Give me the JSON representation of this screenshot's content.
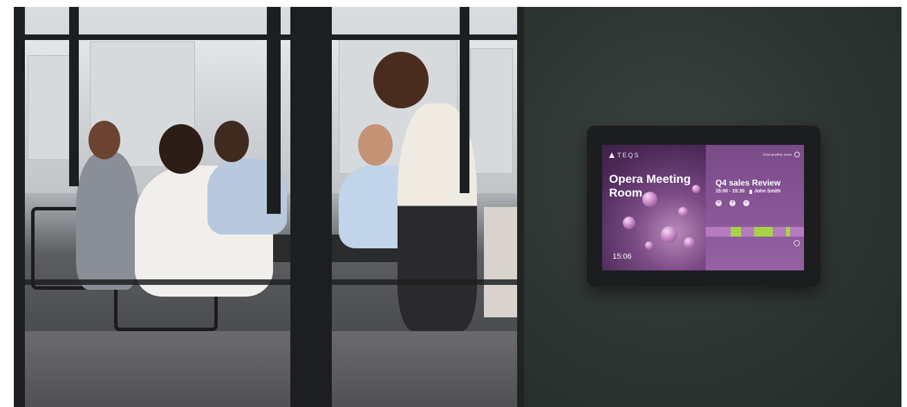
{
  "tablet": {
    "brand": "TEQS",
    "room_name": "Opera Meeting Room",
    "clock_time": "15:06",
    "clock_date": "",
    "find_room_label": "Find another room",
    "meeting_status": "",
    "meeting_title": "Q4 sales Review",
    "meeting_time": "15:00 - 15:30",
    "meeting_organizer": "John Smith",
    "agenda_label": "",
    "timeline_hours": [
      "",
      "",
      "",
      "",
      ""
    ],
    "timeline_slots": [
      {
        "start": 0.25,
        "end": 0.36
      },
      {
        "start": 0.49,
        "end": 0.68
      },
      {
        "start": 0.82,
        "end": 0.86
      }
    ],
    "colors": {
      "screen_accent": "#6b3f7a",
      "timeline_busy": "#a6d34a",
      "timeline_free": "#b77bbf",
      "wall": "#2d3532"
    }
  }
}
